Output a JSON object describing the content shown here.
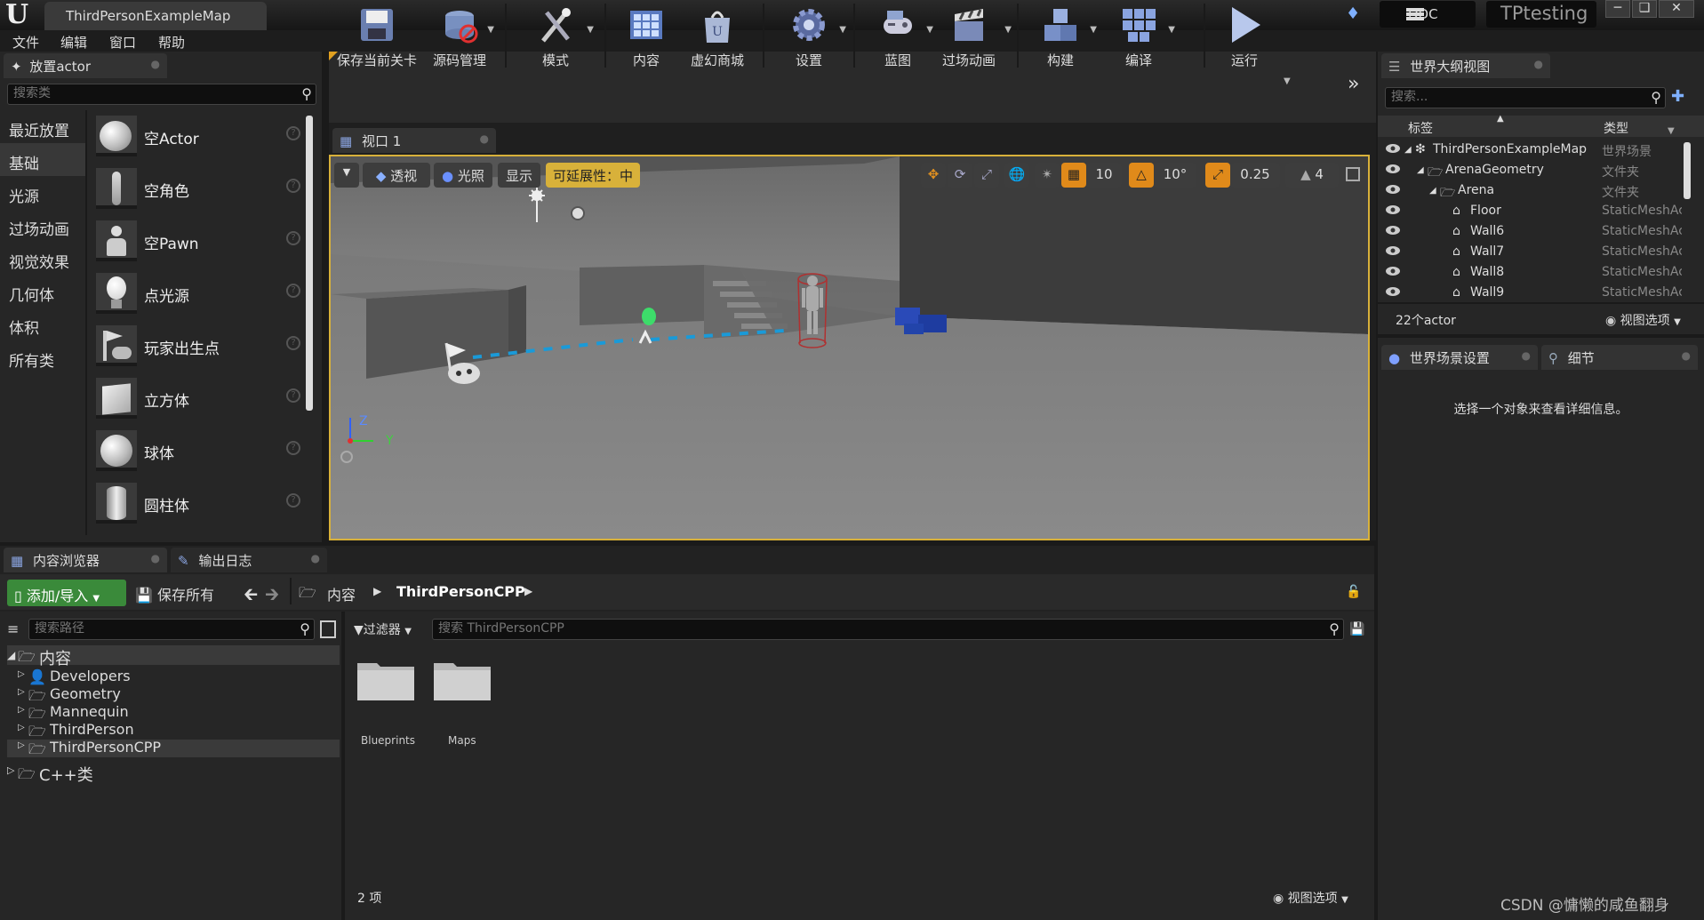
{
  "window": {
    "document_tab": "ThirdPersonExampleMap",
    "ddc": "DDC",
    "project": "TPtesting"
  },
  "menu": [
    "文件",
    "编辑",
    "窗口",
    "帮助"
  ],
  "place_actor": {
    "tab": "放置actor",
    "search_placeholder": "搜索类",
    "categories": [
      "最近放置",
      "基础",
      "光源",
      "过场动画",
      "视觉效果",
      "几何体",
      "体积",
      "所有类"
    ],
    "selected_category": "基础",
    "actors": [
      "空Actor",
      "空角色",
      "空Pawn",
      "点光源",
      "玩家出生点",
      "立方体",
      "球体",
      "圆柱体"
    ]
  },
  "toolbar": {
    "buttons": [
      "保存当前关卡",
      "源码管理",
      "模式",
      "内容",
      "虚幻商城",
      "设置",
      "蓝图",
      "过场动画",
      "构建",
      "编译",
      "运行"
    ]
  },
  "viewport": {
    "tab": "视口 1",
    "perspective": "透视",
    "lighting": "光照",
    "show": "显示",
    "scalability": "可延展性：中",
    "grid_snap": "10",
    "rotation_snap": "10°",
    "scale_snap": "0.25",
    "camera_speed": "4",
    "axis_z": "Z",
    "axis_y": "Y"
  },
  "outliner": {
    "tab": "世界大纲视图",
    "search_placeholder": "搜索...",
    "col_label": "标签",
    "col_type": "类型",
    "rows": [
      {
        "name": "ThirdPersonExampleMap",
        "type": "世界场景",
        "indent": 0
      },
      {
        "name": "ArenaGeometry",
        "type": "文件夹",
        "indent": 1
      },
      {
        "name": "Arena",
        "type": "文件夹",
        "indent": 2
      },
      {
        "name": "Floor",
        "type": "StaticMeshActor",
        "indent": 3
      },
      {
        "name": "Wall6",
        "type": "StaticMeshActor",
        "indent": 3
      },
      {
        "name": "Wall7",
        "type": "StaticMeshActor",
        "indent": 3
      },
      {
        "name": "Wall8",
        "type": "StaticMeshActor",
        "indent": 3
      },
      {
        "name": "Wall9",
        "type": "StaticMeshActor",
        "indent": 3
      }
    ],
    "count": "22个actor",
    "view_options": "视图选项"
  },
  "details": {
    "tab_world": "世界场景设置",
    "tab_details": "细节",
    "empty_message": "选择一个对象来查看详细信息。"
  },
  "content_browser": {
    "tab": "内容浏览器",
    "output_tab": "输出日志",
    "add_import": "添加/导入",
    "save_all": "保存所有",
    "breadcrumb_root": "内容",
    "breadcrumb_current": "ThirdPersonCPP",
    "path_search_placeholder": "搜索路径",
    "filters": "过滤器",
    "asset_search_placeholder": "搜索 ThirdPersonCPP",
    "tree_root": "内容",
    "tree_children": [
      "Developers",
      "Geometry",
      "Mannequin",
      "ThirdPerson",
      "ThirdPersonCPP"
    ],
    "tree_selected": "ThirdPersonCPP",
    "tree_cpp": "C++类",
    "folders": [
      "Blueprints",
      "Maps"
    ],
    "item_count": "2 项",
    "view_options": "视图选项"
  },
  "watermark": "CSDN @慵懒的咸鱼翻身"
}
